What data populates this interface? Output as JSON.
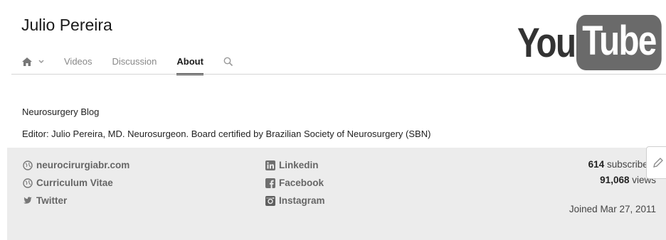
{
  "channel": {
    "name": "Julio Pereira"
  },
  "logo": {
    "part1": "You",
    "part2": "Tube"
  },
  "tabs": [
    {
      "label": "Videos"
    },
    {
      "label": "Discussion"
    },
    {
      "label": "About",
      "active": true
    }
  ],
  "about": {
    "title": "Neurosurgery Blog",
    "description": "Editor: Julio Pereira, MD. Neurosurgeon. Board certified by Brazilian Society of Neurosurgery (SBN)"
  },
  "links": {
    "website": "neurocirurgiabr.com",
    "cv": "Curriculum Vitae",
    "twitter": "Twitter",
    "linkedin": "Linkedin",
    "facebook": "Facebook",
    "instagram": "Instagram"
  },
  "stats": {
    "subscribers_count": "614",
    "subscribers_label": "subscribers",
    "views_count": "91,068",
    "views_label": "views",
    "joined": "Joined Mar 27, 2011"
  },
  "icons": {
    "home": "home-icon",
    "dropdown": "chevron-down-icon",
    "search": "search-icon",
    "globe": "globe-icon",
    "twitter": "twitter-icon",
    "linkedin": "linkedin-icon",
    "facebook": "facebook-icon",
    "instagram": "instagram-icon",
    "edit": "pencil-icon"
  }
}
